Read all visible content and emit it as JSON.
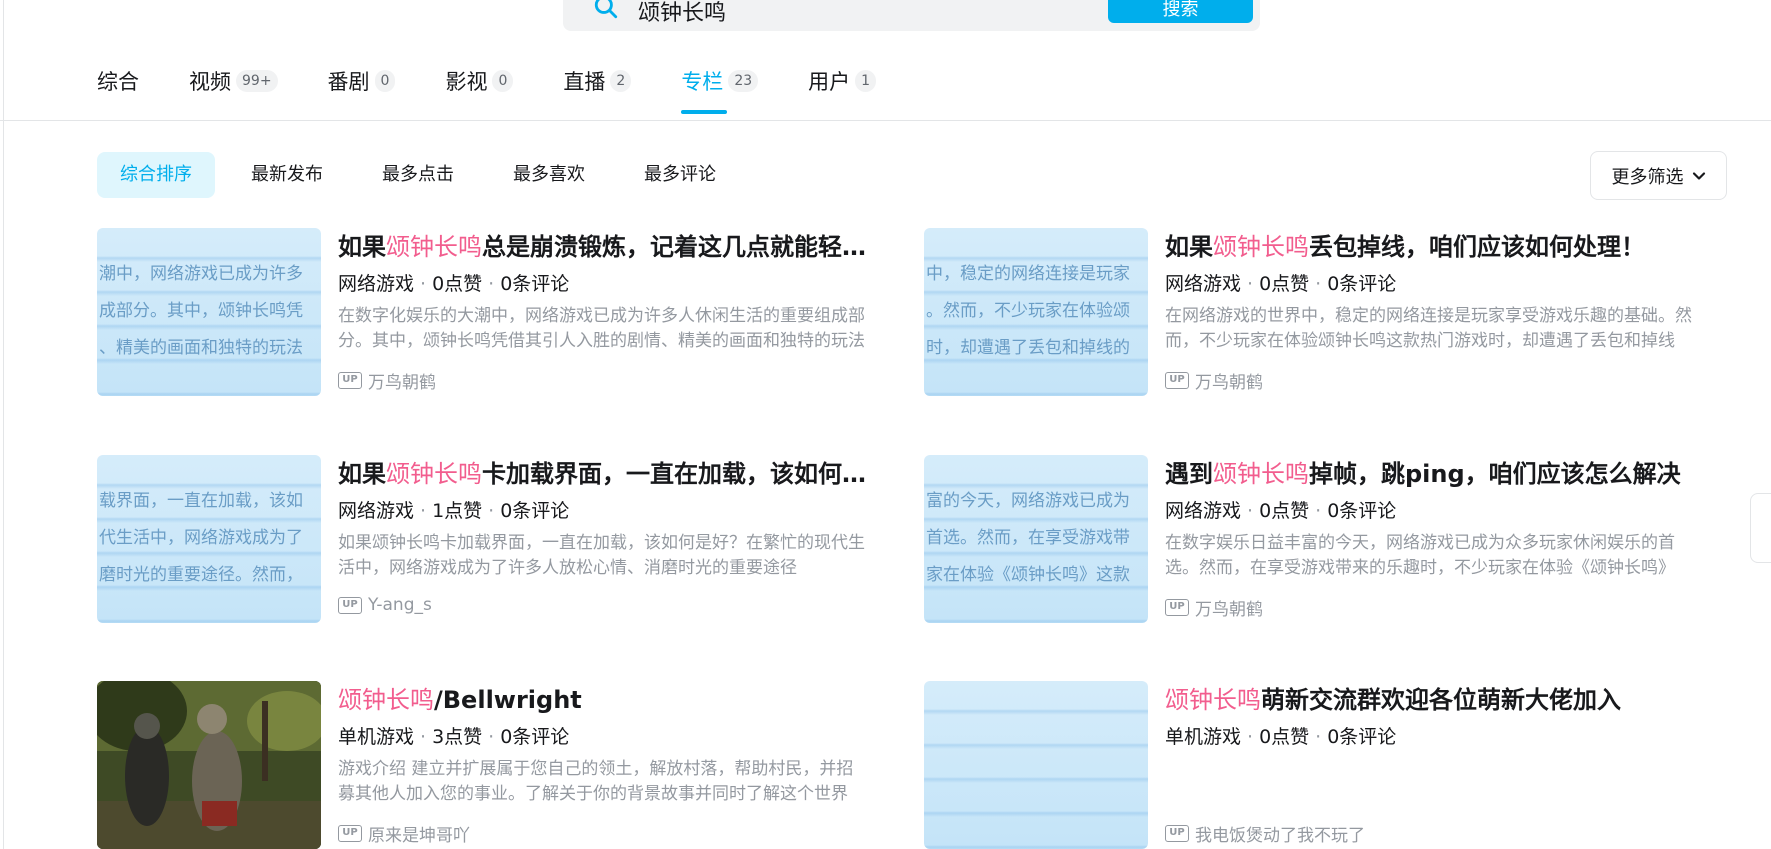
{
  "search": {
    "value": "颂钟长鸣",
    "button_label": "搜索"
  },
  "tabs": [
    {
      "label": "综合",
      "count": ""
    },
    {
      "label": "视频",
      "count": "99+"
    },
    {
      "label": "番剧",
      "count": "0"
    },
    {
      "label": "影视",
      "count": "0"
    },
    {
      "label": "直播",
      "count": "2"
    },
    {
      "label": "专栏",
      "count": "23",
      "active": true
    },
    {
      "label": "用户",
      "count": "1"
    }
  ],
  "sort": {
    "items": [
      "综合排序",
      "最新发布",
      "最多点击",
      "最多喜欢",
      "最多评论"
    ],
    "active_index": 0,
    "more_filter_label": "更多筛选"
  },
  "highlight_keyword": "颂钟长鸣",
  "articles": [
    {
      "title_prefix": "如果",
      "title_hl": "颂钟长鸣",
      "title_suffix": "总是崩溃锻炼，记着这几点就能轻松解决",
      "category": "网络游戏",
      "likes": "0点赞",
      "comments": "0条评论",
      "desc": "在数字化娱乐的大潮中，网络游戏已成为许多人休闲生活的重要组成部分。其中，颂钟长鸣凭借其引人入胜的剧情、精美的画面和独特的玩法",
      "author": "万鸟朝鹤",
      "thumb_lines": [
        "潮中，网络游戏已成为许多",
        "成部分。其中，颂钟长鸣凭",
        "、精美的画面和独特的玩法"
      ]
    },
    {
      "title_prefix": "如果",
      "title_hl": "颂钟长鸣",
      "title_suffix": "丢包掉线，咱们应该如何处理！",
      "category": "网络游戏",
      "likes": "0点赞",
      "comments": "0条评论",
      "desc": "在网络游戏的世界中，稳定的网络连接是玩家享受游戏乐趣的基础。然而，不少玩家在体验颂钟长鸣这款热门游戏时，却遭遇了丢包和掉线",
      "author": "万鸟朝鹤",
      "thumb_lines": [
        "中，稳定的网络连接是玩家",
        "。然而，不少玩家在体验颂",
        "时，却遭遇了丢包和掉线的"
      ]
    },
    {
      "title_prefix": "如果",
      "title_hl": "颂钟长鸣",
      "title_suffix": "卡加载界面，一直在加载，该如何是好",
      "category": "网络游戏",
      "likes": "1点赞",
      "comments": "0条评论",
      "desc": "如果颂钟长鸣卡加载界面，一直在加载，该如何是好？在繁忙的现代生活中，网络游戏成为了许多人放松心情、消磨时光的重要途径",
      "author": "Y-ang_s",
      "thumb_lines": [
        "载界面，一直在加载，该如",
        "代生活中，网络游戏成为了",
        "磨时光的重要途径。然而，"
      ]
    },
    {
      "title_prefix": "遇到",
      "title_hl": "颂钟长鸣",
      "title_suffix": "掉帧，跳ping，咱们应该怎么解决",
      "category": "网络游戏",
      "likes": "0点赞",
      "comments": "0条评论",
      "desc": "在数字娱乐日益丰富的今天，网络游戏已成为众多玩家休闲娱乐的首选。然而，在享受游戏带来的乐趣时，不少玩家在体验《颂钟长鸣》",
      "author": "万鸟朝鹤",
      "thumb_lines": [
        "富的今天，网络游戏已成为",
        "首选。然而，在享受游戏带",
        "家在体验《颂钟长鸣》这款"
      ]
    },
    {
      "title_prefix": "",
      "title_hl": "颂钟长鸣",
      "title_suffix": "/Bellwright",
      "category": "单机游戏",
      "likes": "3点赞",
      "comments": "0条评论",
      "desc": "游戏介绍 建立并扩展属于您自己的领土，解放村落，帮助村民，并招募其他人加入您的事业。了解关于你的背景故事并同时了解这个世界",
      "author": "原来是坤哥吖",
      "photo": true
    },
    {
      "title_prefix": "",
      "title_hl": "颂钟长鸣",
      "title_suffix": "萌新交流群欢迎各位萌新大佬加入",
      "category": "单机游戏",
      "likes": "0点赞",
      "comments": "0条评论",
      "desc": "",
      "author": "我电饭煲动了我不玩了",
      "thumb_lines": []
    }
  ],
  "up_badge": "UP"
}
